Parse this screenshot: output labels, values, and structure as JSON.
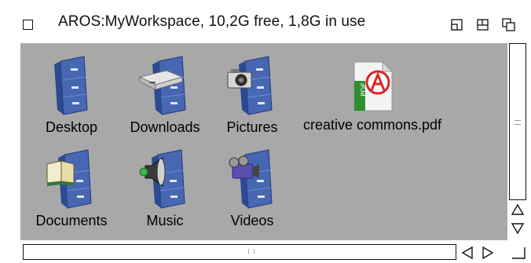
{
  "window": {
    "title": "AROS:MyWorkspace,  10,2G free, 1,8G in use"
  },
  "icons": [
    {
      "label": "Desktop",
      "icon": "cabinet-icon"
    },
    {
      "label": "Downloads",
      "icon": "cabinet-drive-icon"
    },
    {
      "label": "Pictures",
      "icon": "cabinet-camera-icon"
    },
    {
      "label": "creative commons.pdf",
      "icon": "pdf-file-icon"
    },
    {
      "label": "Documents",
      "icon": "cabinet-book-icon"
    },
    {
      "label": "Music",
      "icon": "cabinet-speaker-icon"
    },
    {
      "label": "Videos",
      "icon": "cabinet-videocamera-icon"
    }
  ],
  "colors": {
    "content_bg": "#a8a8a8",
    "cabinet": "#3f5fa8",
    "pdf_red": "#d8262a",
    "pdf_green": "#2f8f2f"
  }
}
